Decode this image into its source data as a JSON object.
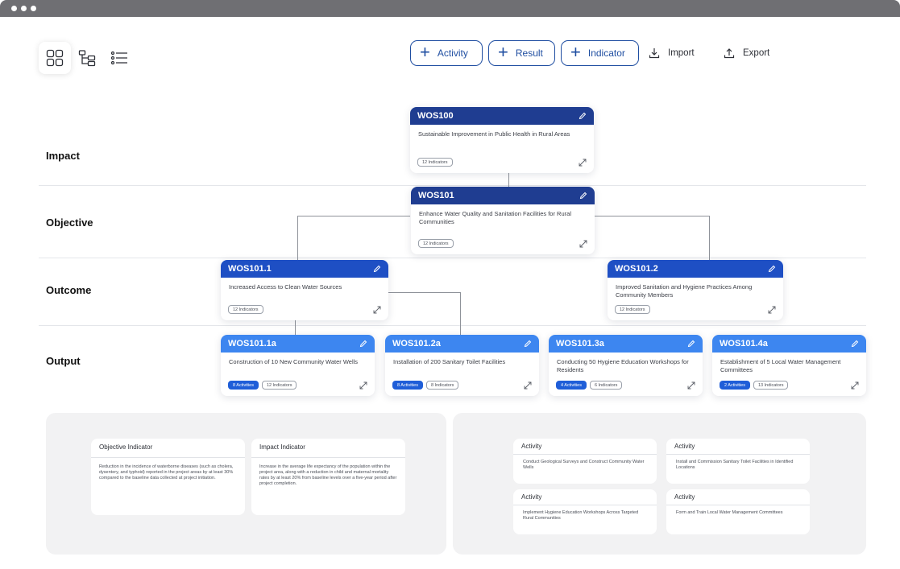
{
  "toolbar": {
    "activity_label": "Activity",
    "result_label": "Result",
    "indicator_label": "Indicator",
    "import_label": "Import",
    "export_label": "Export"
  },
  "view_modes": [
    "grid-view-icon",
    "tree-view-icon",
    "list-view-icon"
  ],
  "levels": {
    "impact": "Impact",
    "objective": "Objective",
    "outcome": "Outcome",
    "output": "Output"
  },
  "cards": {
    "impact": {
      "code": "WOS100",
      "desc": "Sustainable Improvement in Public Health in Rural Areas",
      "indicators": "12 Indicators"
    },
    "objective": {
      "code": "WOS101",
      "desc": "Enhance Water Quality and Sanitation Facilities for Rural Communities",
      "indicators": "12 Indicators"
    },
    "outcome1": {
      "code": "WOS101.1",
      "desc": "Increased Access to Clean Water Sources",
      "indicators": "12 Indicators"
    },
    "outcome2": {
      "code": "WOS101.2",
      "desc": "Improved Sanitation and Hygiene Practices Among Community Members",
      "indicators": "12 Indicators"
    },
    "output1": {
      "code": "WOS101.1a",
      "desc": "Construction of 10 New Community Water Wells",
      "activities": "8 Activities",
      "indicators": "12 Indicators"
    },
    "output2": {
      "code": "WOS101.2a",
      "desc": "Installation of 200 Sanitary Toilet Facilities",
      "activities": "8 Activities",
      "indicators": "8 Indicators"
    },
    "output3": {
      "code": "WOS101.3a",
      "desc": "Conducting 50 Hygiene Education Workshops for Residents",
      "activities": "4 Activities",
      "indicators": "6 Indicators"
    },
    "output4": {
      "code": "WOS101.4a",
      "desc": "Establishment of 5 Local Water Management Committees",
      "activities": "2 Activities",
      "indicators": "13 Indicators"
    }
  },
  "indicator_panel": {
    "objective_title": "Objective Indicator",
    "objective_text": "Reduction in the incidence of waterborne diseases (such as cholera, dysentery, and typhoid) reported in the project areas by at least 30% compared to the baseline data collected at project initiation.",
    "impact_title": "Impact Indicator",
    "impact_text": "Increase in the average life expectancy of the population within the project area, along with a reduction in child and maternal mortality rates by at least 20% from baseline levels over a five-year period after project completion."
  },
  "activity_panel": {
    "items": [
      {
        "title": "Activity",
        "text": "Conduct Geological Surveys and Construct Community Water Wells"
      },
      {
        "title": "Activity",
        "text": "Install and Commission Sanitary Toilet Facilities in Identified Locations"
      },
      {
        "title": "Activity",
        "text": "Implement Hygiene Education Workshops Across Targeted Rural Communities"
      },
      {
        "title": "Activity",
        "text": "Form and Train Local Water Management Committees"
      }
    ]
  },
  "colors": {
    "dark_header": "#1f3d91",
    "mid_header": "#1e4fc4",
    "light_header": "#3d86f0",
    "accent": "#1f4ea1"
  }
}
